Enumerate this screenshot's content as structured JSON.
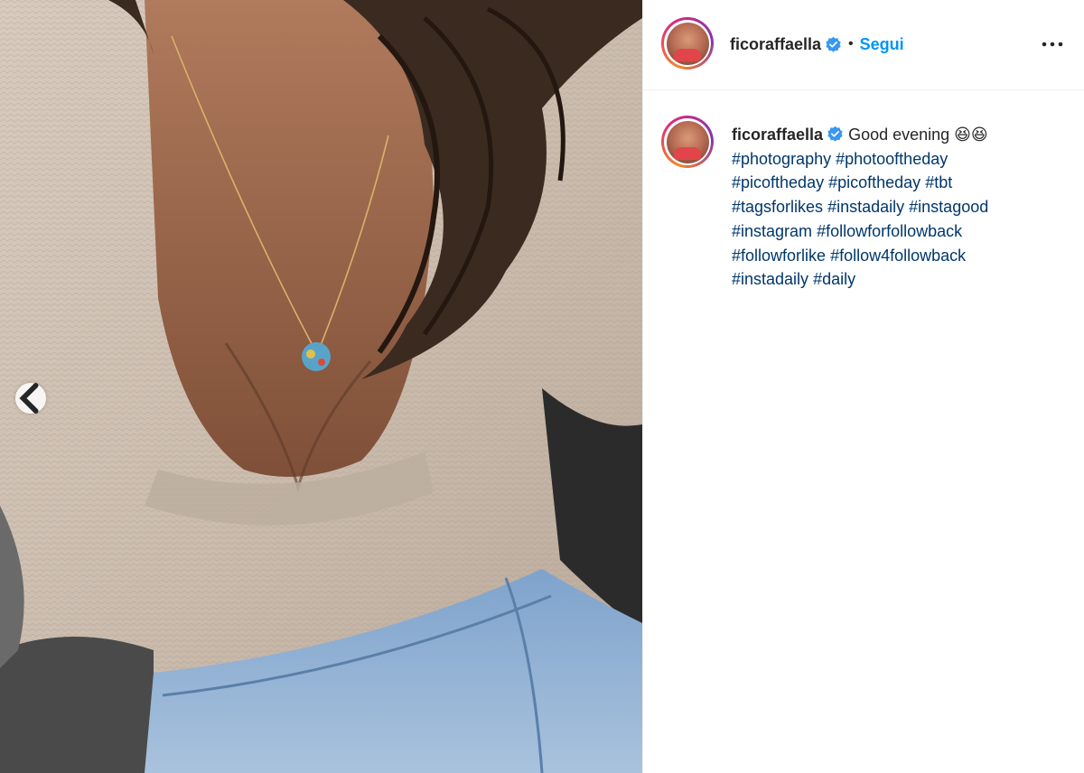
{
  "post": {
    "username": "ficoraffaella",
    "follow_label": "Segui",
    "separator": "•",
    "caption_text": "Good evening 😆😆",
    "hashtags": [
      "#photography",
      "#photooftheday",
      "#picoftheday",
      "#picoftheday",
      "#tbt",
      "#tagsforlikes",
      "#instadaily",
      "#instagood",
      "#instagram",
      "#followforfollowback",
      "#followforlike",
      "#follow4followback",
      "#instadaily",
      "#daily"
    ]
  },
  "icons": {
    "verified": "verified-badge-icon",
    "more": "more-options-icon",
    "carousel_prev": "chevron-left-icon"
  },
  "colors": {
    "follow": "#0095f6",
    "hashtag": "#00376b",
    "verified": "#3897f0",
    "text": "#262626"
  }
}
